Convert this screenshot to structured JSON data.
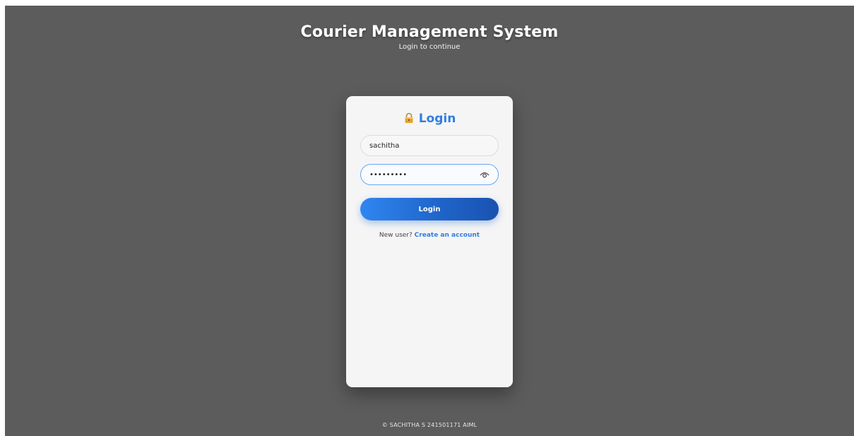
{
  "header": {
    "title": "Courier Management System",
    "subtitle": "Login to continue"
  },
  "login_card": {
    "title": "Login",
    "title_icon": "lock-icon",
    "username": {
      "value": "sachitha"
    },
    "password": {
      "value": "•••••••••",
      "toggle_icon": "eye-icon"
    },
    "submit_label": "Login",
    "signup_prompt": "New user?",
    "signup_link": "Create an account"
  },
  "footer": {
    "text": "© SACHITHA S 241501171 AIML"
  },
  "colors": {
    "background": "#5c5c5c",
    "accent": "#2f7ee0",
    "card": "#f5f5f6"
  }
}
